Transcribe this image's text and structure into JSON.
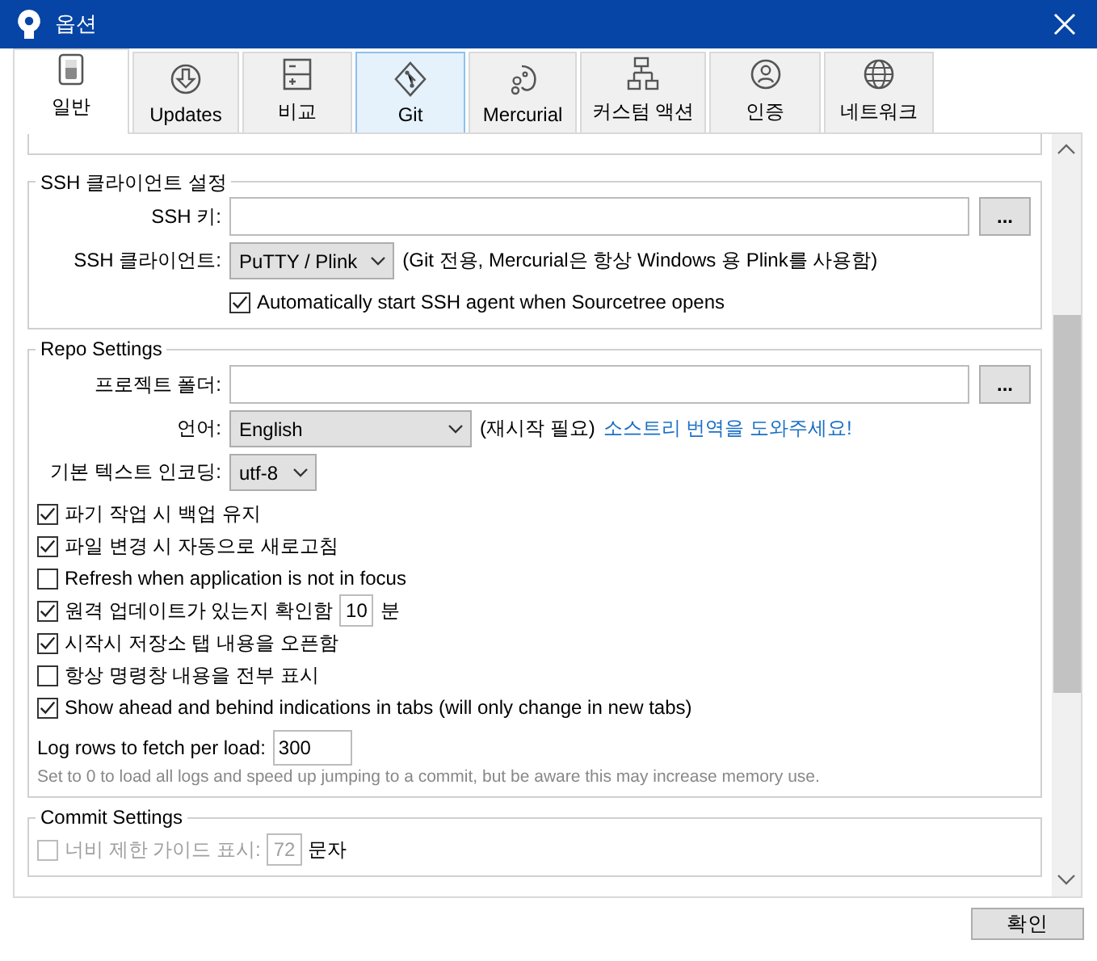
{
  "window": {
    "title": "옵션"
  },
  "tabs": [
    {
      "label": "일반",
      "kind": "general",
      "selected": true,
      "hovered": false
    },
    {
      "label": "Updates",
      "kind": "updates",
      "selected": false,
      "hovered": false
    },
    {
      "label": "비교",
      "kind": "diff",
      "selected": false,
      "hovered": false
    },
    {
      "label": "Git",
      "kind": "git",
      "selected": false,
      "hovered": true
    },
    {
      "label": "Mercurial",
      "kind": "mercurial",
      "selected": false,
      "hovered": false
    },
    {
      "label": "커스텀 액션",
      "kind": "custom",
      "selected": false,
      "hovered": false
    },
    {
      "label": "인증",
      "kind": "auth",
      "selected": false,
      "hovered": false
    },
    {
      "label": "네트워크",
      "kind": "network",
      "selected": false,
      "hovered": false
    }
  ],
  "groups": [
    {
      "title": "SSH 클라이언트 설정",
      "items": [
        {
          "kind": "path",
          "label": "SSH 키:",
          "button": "..."
        },
        {
          "kind": "select",
          "label": "SSH 클라이언트:",
          "value": "PuTTY / Plink",
          "note": "(Git 전용, Mercurial은 항상 Windows 용 Plink를 사용함)"
        },
        {
          "kind": "aligned-checkbox",
          "label": "Automatically start SSH agent when Sourcetree opens",
          "checked": true
        }
      ]
    },
    {
      "title": "Repo Settings",
      "items": [
        {
          "kind": "path",
          "label": "프로젝트 폴더:",
          "button": "..."
        },
        {
          "kind": "select",
          "label": "언어:",
          "value": "English",
          "note": "(재시작 필요)",
          "link": "소스트리 번역을 도와주세요!"
        },
        {
          "kind": "select",
          "label": "기본 텍스트 인코딩:",
          "value": "utf-8"
        },
        {
          "kind": "checkbox",
          "label": "파기 작업 시 백업 유지",
          "checked": true
        },
        {
          "kind": "checkbox",
          "label": "파일 변경 시 자동으로 새로고침",
          "checked": true
        },
        {
          "kind": "checkbox",
          "label": "Refresh when application is not in focus",
          "checked": false
        },
        {
          "kind": "checkbox-number",
          "label": "원격 업데이트가 있는지 확인함",
          "checked": true,
          "value": "10",
          "unit": "분"
        },
        {
          "kind": "checkbox",
          "label": "시작시 저장소 탭 내용을 오픈함",
          "checked": true
        },
        {
          "kind": "checkbox",
          "label": "항상 명령창 내용을 전부 표시",
          "checked": false
        },
        {
          "kind": "checkbox",
          "label": "Show ahead and behind indications in tabs (will only change in new tabs)",
          "checked": true
        },
        {
          "kind": "number",
          "label": "Log rows to fetch per load:",
          "value": "300"
        },
        {
          "kind": "hint",
          "text": "Set to 0 to load all logs and speed up jumping to a commit, but be aware this may increase memory use."
        }
      ]
    },
    {
      "title": "Commit Settings",
      "items": [
        {
          "kind": "checkbox-number",
          "label": "너비 제한 가이드 표시:",
          "checked": false,
          "disabled": true,
          "value": "72",
          "unit": "문자"
        }
      ]
    }
  ],
  "buttons": [
    "확인"
  ]
}
